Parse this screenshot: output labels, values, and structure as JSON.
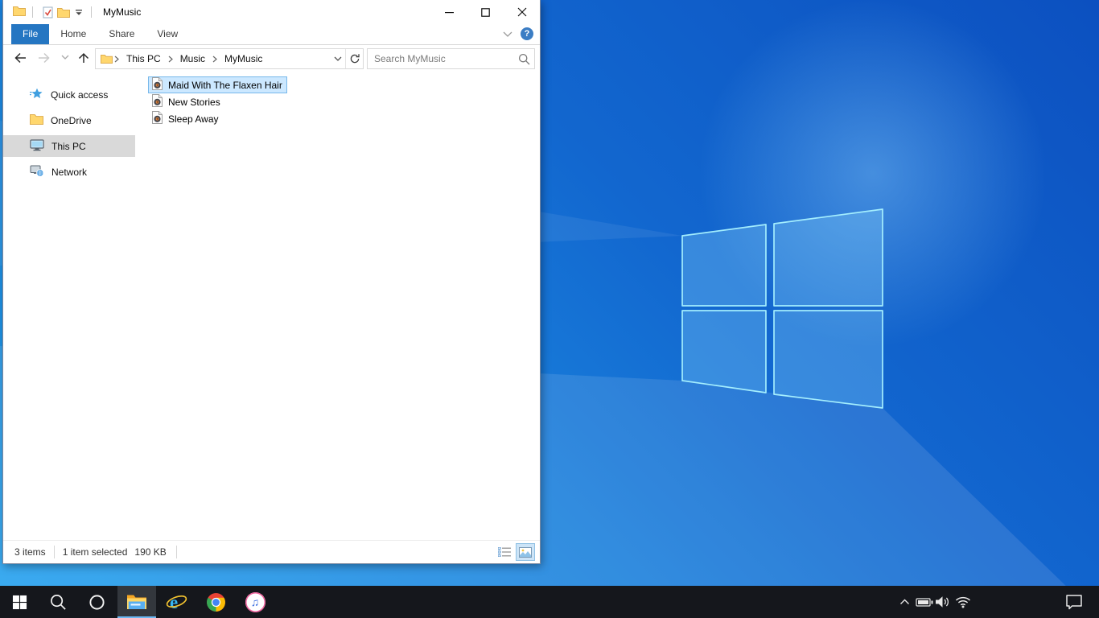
{
  "desktop": {
    "wallpaper_colors": {
      "bottom_left": "#22a0ee",
      "mid": "#1267cf",
      "top_right": "#0c50c0",
      "logo_stroke": "#9df0ff"
    }
  },
  "explorer": {
    "window_title": "MyMusic",
    "tabs": [
      "File",
      "Home",
      "Share",
      "View"
    ],
    "active_tab": "File",
    "help_glyph": "?",
    "breadcrumb_items": [
      "This PC",
      "Music",
      "MyMusic"
    ],
    "search_placeholder": "Search MyMusic",
    "sidebar_items": [
      {
        "label": "Quick access",
        "selected": false
      },
      {
        "label": "OneDrive",
        "selected": false
      },
      {
        "label": "This PC",
        "selected": true
      },
      {
        "label": "Network",
        "selected": false
      }
    ],
    "files": [
      {
        "name": "Maid With The Flaxen Hair",
        "selected": true
      },
      {
        "name": "New Stories",
        "selected": false
      },
      {
        "name": "Sleep Away",
        "selected": false
      }
    ],
    "status_bar": {
      "item_count": "3 items",
      "selection_count": "1 item selected",
      "selection_size": "190 KB"
    },
    "colors": {
      "file_tab_bg": "#2576c2",
      "selection_bg": "#cce8ff",
      "selection_border": "#77b8ea",
      "sidebar_selected_bg": "#d9d9d9"
    }
  },
  "taskbar": {
    "glyphs": {
      "ie": "e",
      "itunes": "♫"
    },
    "colors": {
      "bg": "#15171c",
      "active_underline": "#6cb8f2"
    }
  }
}
